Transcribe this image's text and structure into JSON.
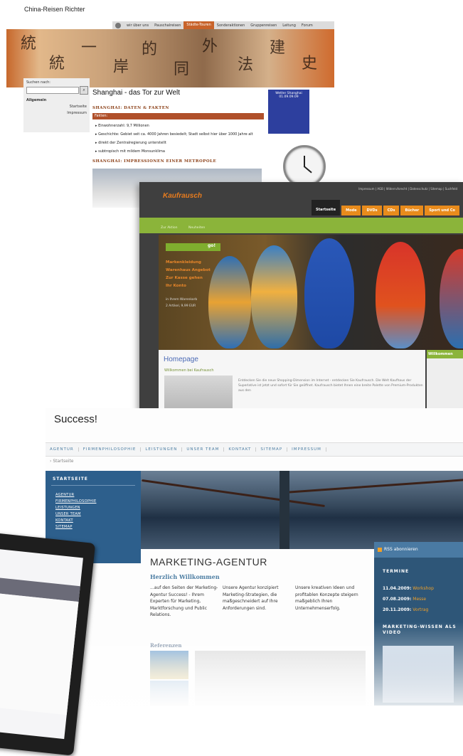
{
  "china": {
    "brand": "China-Reisen Richter",
    "nav": [
      "wir über uns",
      "Pauschalreisen",
      "Städte-Touren",
      "Sonderaktionen",
      "Gruppenreisen",
      "Leitung",
      "Forum"
    ],
    "nav_active_index": 2,
    "search_label": "Suchen nach:",
    "left_heading": "Allgemein",
    "left_links": [
      "Startseite",
      "Impressum"
    ],
    "title": "Shanghai -  das Tor zur Welt",
    "section_facts": "SHANGHAI: DATEN & FAKTEN",
    "fact_bar": "Fakten:",
    "facts": [
      "Einwohnerzahl: 9,7 Millionen",
      "Geschichte: Gebiet seit ca. 4000 Jahren besiedelt; Stadt selbst hier über 1000 Jahre alt",
      "direkt der Zentralregierung unterstellt",
      "subtropisch mit mildem Monsunklima"
    ],
    "section_impressions": "SHANGHAI: IMPRESSIONEN EINER METROPOLE",
    "weather_title": "Wetter Shanghai",
    "weather_date": "01.09.09.09"
  },
  "kauf": {
    "logo": "Kaufrausch",
    "toplinks": "Impressum  |  AGB  |  Widerrufsrecht  |  Datenschutz  |  Sitemap  |  Suchfeld",
    "tabs": [
      "Startseite",
      "Mode",
      "DVDs",
      "CDs",
      "Bücher",
      "Sport und Co"
    ],
    "crumbs": [
      "Zur Aktion",
      "Neuheiten"
    ],
    "promo_go": "go!",
    "promo_links": [
      "Markenkleidung",
      "Warenhaus Angebot",
      "Zur Kasse gehen",
      "Ihr Konto"
    ],
    "promo_info": [
      "in Ihrem Warenkorb",
      "2 Artikel, 9,99 EUR"
    ],
    "content_title": "Homepage",
    "content_sub": "Willkommen bei Kaufrausch",
    "content_text": "Entdecken Sie die neue Shopping-Dimension im Internet - entdecken Sie Kaufrausch. Die Welt Kaufhaus der Superlative ist jetzt und sofort für Sie geöffnet. Kaufrausch bietet Ihnen eine breite Palette von Premium-Produkten aus den",
    "side_title": "Willkommen"
  },
  "succ": {
    "logo": "Success!",
    "nav": [
      "AGENTUR",
      "FIRMENPHILOSOPHIE",
      "LEISTUNGEN",
      "UNSER TEAM",
      "KONTAKT",
      "SITEMAP",
      "IMPRESSUM"
    ],
    "crumb": "Startseite",
    "left_head": "STARTSEITE",
    "left_items": [
      "AGENTUR",
      "FIRMENPHILOSOPHIE",
      "LEISTUNGEN",
      "UNSER TEAM",
      "KONTAKT",
      "SITEMAP"
    ],
    "main_title": "MARKETING-AGENTUR",
    "welcome": "Herzlich Willkommen",
    "columns": [
      "...auf den Seiten der Marketing-Agentur Success! - Ihrem Experten für Marketing, Marktforschung und Public Relations.",
      "Unsere Agentur konzipiert Marketing-Strategien, die maßgeschneidert auf Ihre Anforderungen sind.",
      "Unsere kreativen Ideen und profitablen Konzepte steigern maßgeblich Ihren Unternehmenserfolg."
    ],
    "references": "Referenzen",
    "rss": "RSS abonnieren",
    "terms_head": "TERMINE",
    "terms": [
      {
        "date": "11.04.2009:",
        "label": "Workshop"
      },
      {
        "date": "07.08.2009:",
        "label": "Messe"
      },
      {
        "date": "20.11.2009:",
        "label": "Vortrag"
      }
    ],
    "video_head": "MARKETING-WISSEN ALS VIDEO"
  }
}
